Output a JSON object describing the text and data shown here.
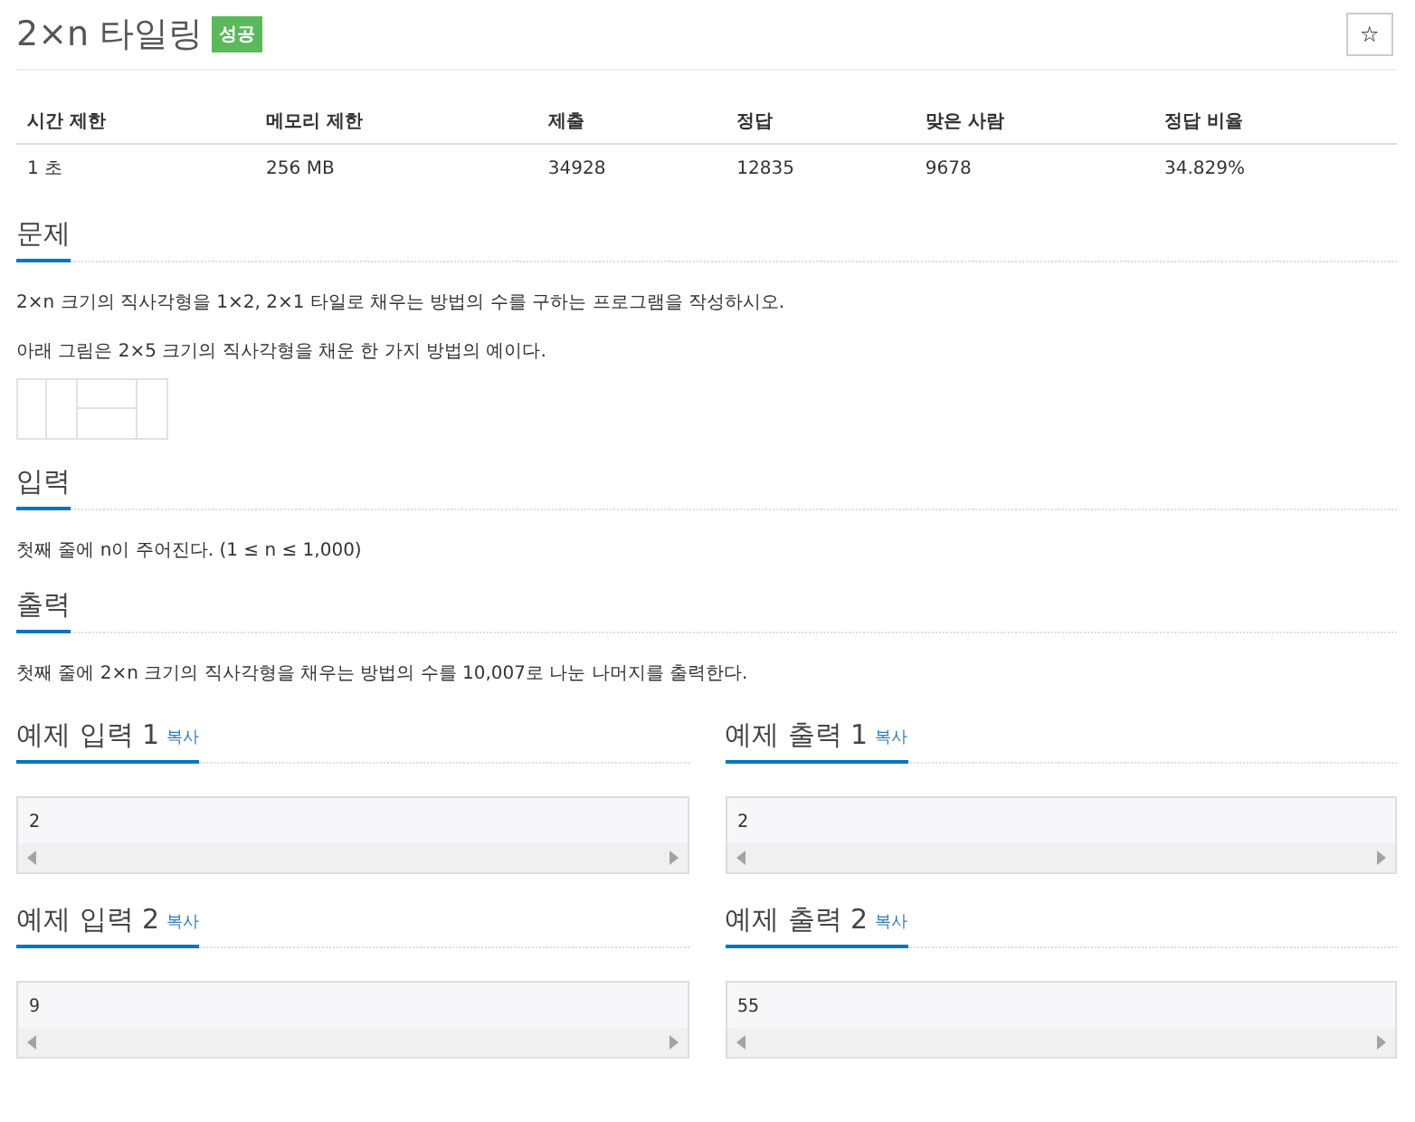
{
  "title": "2×n 타일링",
  "badge": "성공",
  "star_button": "☆",
  "stats": {
    "columns": [
      "시간 제한",
      "메모리 제한",
      "제출",
      "정답",
      "맞은 사람",
      "정답 비율"
    ],
    "values": [
      "1 초",
      "256 MB",
      "34928",
      "12835",
      "9678",
      "34.829%"
    ]
  },
  "sections": [
    {
      "heading": "문제",
      "paragraphs": [
        "2×n 크기의 직사각형을 1×2, 2×1 타일로 채우는 방법의 수를 구하는 프로그램을 작성하시오.",
        "아래 그림은 2×5 크기의 직사각형을 채운 한 가지 방법의 예이다."
      ],
      "kind": "figure"
    },
    {
      "heading": "입력",
      "paragraphs": [
        "첫째 줄에 n이 주어진다. (1 ≤ n ≤ 1,000)"
      ],
      "kind": "text"
    },
    {
      "heading": "출력",
      "paragraphs": [
        "첫째 줄에 2×n 크기의 직사각형을 채우는 방법의 수를 10,007로 나눈 나머지를 출력한다."
      ],
      "kind": "text"
    }
  ],
  "samples": [
    {
      "title": "예제 입력 1",
      "copy": "복사",
      "content": "2"
    },
    {
      "title": "예제 출력 1",
      "copy": "복사",
      "content": "2"
    },
    {
      "title": "예제 입력 2",
      "copy": "복사",
      "content": "9"
    },
    {
      "title": "예제 출력 2",
      "copy": "복사",
      "content": "55"
    }
  ]
}
